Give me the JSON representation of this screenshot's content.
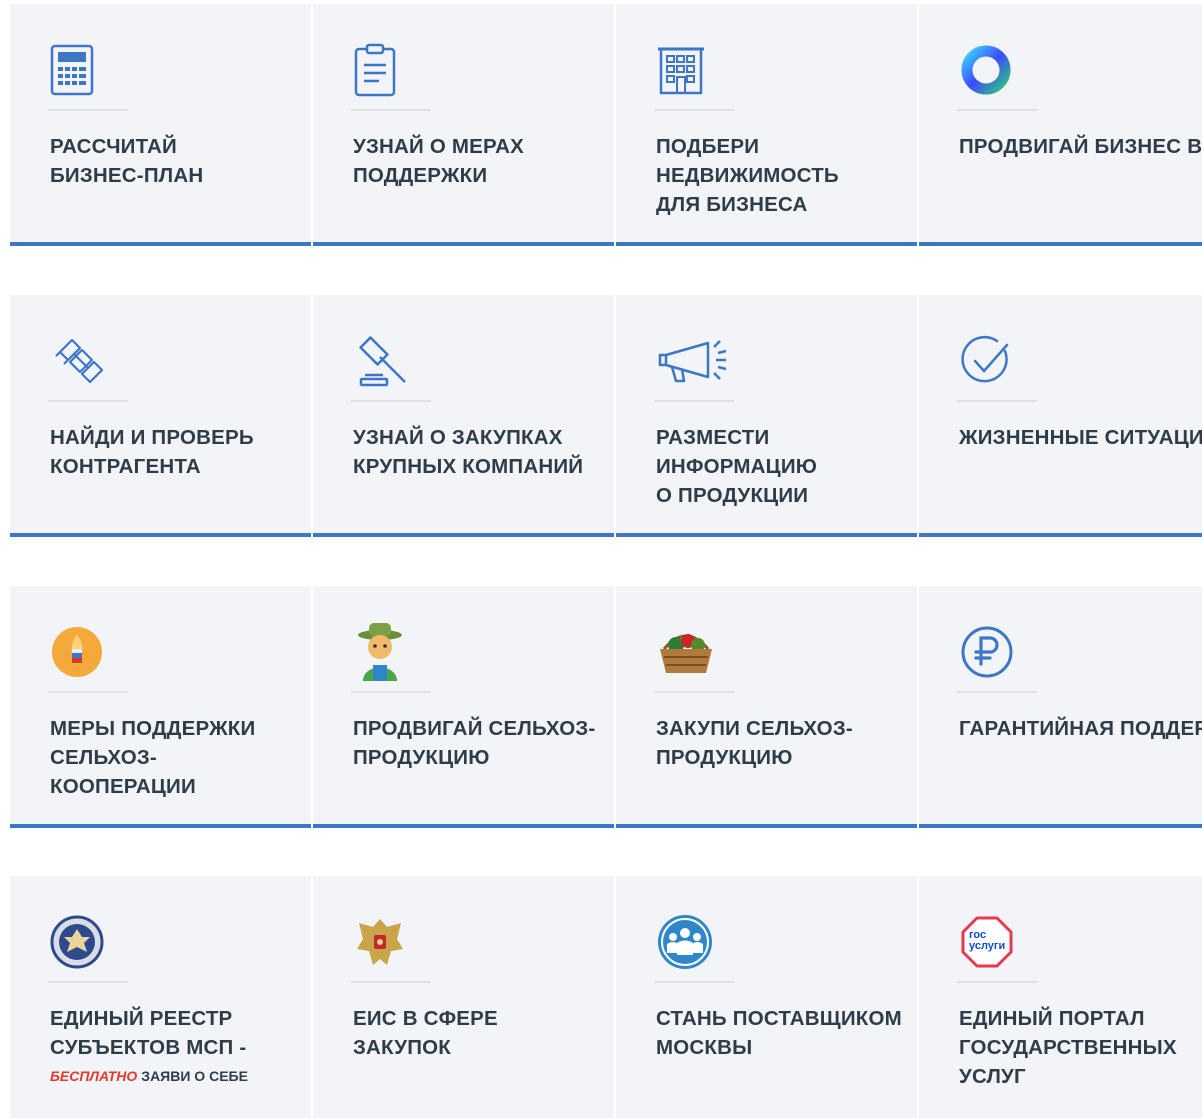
{
  "colors": {
    "accent": "#3c76c5",
    "tile_bg": "#f2f4f7",
    "text": "#2f3d4a",
    "highlight": "#e4382f"
  },
  "tiles": [
    {
      "icon": "calculator-icon",
      "label": "Рассчитай\nбизнес-план"
    },
    {
      "icon": "clipboard-icon",
      "label": "Узнай о мерах\nподдержки"
    },
    {
      "icon": "building-icon",
      "label": "Подбери\nнедвижимость\nдля бизнеса"
    },
    {
      "icon": "ring-logo-icon",
      "label": "Продвигай бизнес в\nинтернете"
    },
    {
      "icon": "binoculars-icon",
      "label": "Найди и проверь\nконтрагента"
    },
    {
      "icon": "gavel-icon",
      "label": "Узнай о закупках\nкрупных компаний"
    },
    {
      "icon": "megaphone-icon",
      "label": "Размести\nинформацию\nо продукции"
    },
    {
      "icon": "check-circle-icon",
      "label": "Жизненные\nситуации"
    },
    {
      "icon": "wheat-emblem-icon",
      "label": "Меры поддержки\nсельхоз-\nкооперации"
    },
    {
      "icon": "farmer-icon",
      "label": "Продвигай сельхоз-\nпродукцию"
    },
    {
      "icon": "basket-icon",
      "label": "Закупи сельхоз-\nпродукцию"
    },
    {
      "icon": "ruble-icon",
      "label": "Гарантийная\nподдержка\nсубъектов МСП"
    },
    {
      "icon": "tax-emblem-icon",
      "label": "Единый реестр\nсубъектов МСП -",
      "note_highlight": "БЕСПЛАТНО",
      "note_text": "ЗАЯВИ О СЕБЕ"
    },
    {
      "icon": "coat-of-arms-icon",
      "label": "ЕИС в сфере\nзакупок"
    },
    {
      "icon": "people-circle-icon",
      "label": "Стань поставщиком\nМосквы"
    },
    {
      "icon": "gosuslugi-icon",
      "label": "Единый портал\nгосударственных\nуслуг",
      "logo_text": "гос услуги"
    }
  ]
}
